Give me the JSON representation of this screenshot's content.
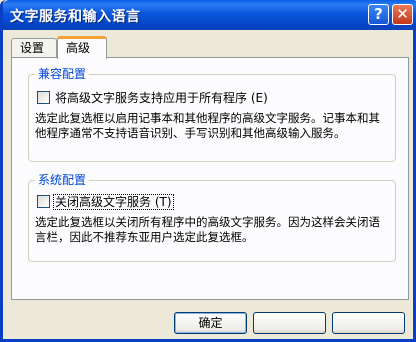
{
  "window": {
    "title": "文字服务和输入语言"
  },
  "titlebar": {
    "help_label": "?",
    "close_label": "✕"
  },
  "tabs": [
    {
      "label": "设置"
    },
    {
      "label": "高级"
    }
  ],
  "groups": {
    "compat": {
      "title": "兼容配置",
      "checkbox_label": "将高级文字服务支持应用于所有程序 (E)",
      "checked": false,
      "description": "选定此复选框以启用记事本和其他程序的高级文字服务。记事本和其他程序通常不支持语音识别、手写识别和其他高级输入服务。"
    },
    "system": {
      "title": "系统配置",
      "checkbox_label": "关闭高级文字服务 (T)",
      "checked": false,
      "description": "选定此复选框以关闭所有程序中的高级文字服务。因为这样会关闭语言栏，因此不推荐东亚用户选定此复选框。"
    }
  },
  "buttons": {
    "ok": "确定",
    "cancel": "",
    "apply": ""
  }
}
